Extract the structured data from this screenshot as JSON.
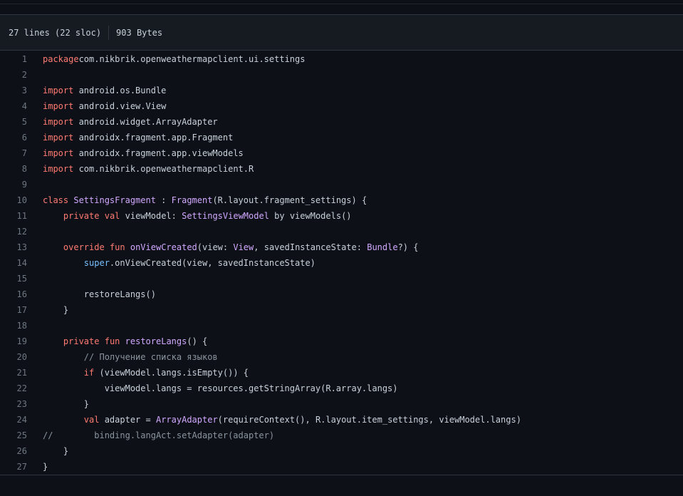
{
  "file_info": {
    "lines": "27 lines (22 sloc)",
    "size": "903 Bytes"
  },
  "code_lines": [
    {
      "n": "1",
      "tokens": [
        [
          "kw",
          "package"
        ],
        [
          "",
          "com.nikbrik.openweathermapclient.ui.settings"
        ]
      ]
    },
    {
      "n": "2",
      "tokens": []
    },
    {
      "n": "3",
      "tokens": [
        [
          "kw",
          "import"
        ],
        [
          "",
          " android.os.Bundle"
        ]
      ]
    },
    {
      "n": "4",
      "tokens": [
        [
          "kw",
          "import"
        ],
        [
          "",
          " android.view.View"
        ]
      ]
    },
    {
      "n": "5",
      "tokens": [
        [
          "kw",
          "import"
        ],
        [
          "",
          " android.widget.ArrayAdapter"
        ]
      ]
    },
    {
      "n": "6",
      "tokens": [
        [
          "kw",
          "import"
        ],
        [
          "",
          " androidx.fragment.app.Fragment"
        ]
      ]
    },
    {
      "n": "7",
      "tokens": [
        [
          "kw",
          "import"
        ],
        [
          "",
          " androidx.fragment.app.viewModels"
        ]
      ]
    },
    {
      "n": "8",
      "tokens": [
        [
          "kw",
          "import"
        ],
        [
          "",
          " com.nikbrik.openweathermapclient.R"
        ]
      ]
    },
    {
      "n": "9",
      "tokens": []
    },
    {
      "n": "10",
      "tokens": [
        [
          "kw",
          "class"
        ],
        [
          "",
          " "
        ],
        [
          "fn",
          "SettingsFragment"
        ],
        [
          "",
          " : "
        ],
        [
          "fn",
          "Fragment"
        ],
        [
          "",
          "(R.layout.fragment_settings) {"
        ]
      ]
    },
    {
      "n": "11",
      "tokens": [
        [
          "",
          "    "
        ],
        [
          "kw",
          "private"
        ],
        [
          "",
          " "
        ],
        [
          "kw",
          "val"
        ],
        [
          "",
          " viewModel: "
        ],
        [
          "fn",
          "SettingsViewModel"
        ],
        [
          "",
          " by viewModels()"
        ]
      ]
    },
    {
      "n": "12",
      "tokens": []
    },
    {
      "n": "13",
      "tokens": [
        [
          "",
          "    "
        ],
        [
          "kw",
          "override"
        ],
        [
          "",
          " "
        ],
        [
          "kw",
          "fun"
        ],
        [
          "",
          " "
        ],
        [
          "fn",
          "onViewCreated"
        ],
        [
          "",
          "(view: "
        ],
        [
          "fn",
          "View"
        ],
        [
          "",
          ", savedInstanceState: "
        ],
        [
          "fn",
          "Bundle"
        ],
        [
          "",
          "?) {"
        ]
      ]
    },
    {
      "n": "14",
      "tokens": [
        [
          "",
          "        "
        ],
        [
          "ty",
          "super"
        ],
        [
          "",
          ".onViewCreated(view, savedInstanceState)"
        ]
      ]
    },
    {
      "n": "15",
      "tokens": []
    },
    {
      "n": "16",
      "tokens": [
        [
          "",
          "        restoreLangs()"
        ]
      ]
    },
    {
      "n": "17",
      "tokens": [
        [
          "",
          "    }"
        ]
      ]
    },
    {
      "n": "18",
      "tokens": []
    },
    {
      "n": "19",
      "tokens": [
        [
          "",
          "    "
        ],
        [
          "kw",
          "private"
        ],
        [
          "",
          " "
        ],
        [
          "kw",
          "fun"
        ],
        [
          "",
          " "
        ],
        [
          "fn",
          "restoreLangs"
        ],
        [
          "",
          "() {"
        ]
      ]
    },
    {
      "n": "20",
      "tokens": [
        [
          "",
          "        "
        ],
        [
          "cm",
          "// Получение списка языков"
        ]
      ]
    },
    {
      "n": "21",
      "tokens": [
        [
          "",
          "        "
        ],
        [
          "kw",
          "if"
        ],
        [
          "",
          " (viewModel.langs.isEmpty()) {"
        ]
      ]
    },
    {
      "n": "22",
      "tokens": [
        [
          "",
          "            viewModel.langs = resources.getStringArray(R.array.langs)"
        ]
      ]
    },
    {
      "n": "23",
      "tokens": [
        [
          "",
          "        }"
        ]
      ]
    },
    {
      "n": "24",
      "tokens": [
        [
          "",
          "        "
        ],
        [
          "kw",
          "val"
        ],
        [
          "",
          " adapter = "
        ],
        [
          "fn",
          "ArrayAdapter"
        ],
        [
          "",
          "(requireContext(), R.layout.item_settings, viewModel.langs)"
        ]
      ]
    },
    {
      "n": "25",
      "tokens": [
        [
          "cm",
          "//        binding.langAct.setAdapter(adapter)"
        ]
      ]
    },
    {
      "n": "26",
      "tokens": [
        [
          "",
          "    }"
        ]
      ]
    },
    {
      "n": "27",
      "tokens": [
        [
          "",
          "}"
        ]
      ]
    }
  ],
  "colors": {
    "background": "#0d1117",
    "header_bg": "#161b22",
    "keyword": "#ff7b72",
    "function": "#d2a8ff",
    "constant": "#79c0ff",
    "comment": "#8b949e",
    "line_number": "#6e7681",
    "text": "#c9d1d9"
  }
}
